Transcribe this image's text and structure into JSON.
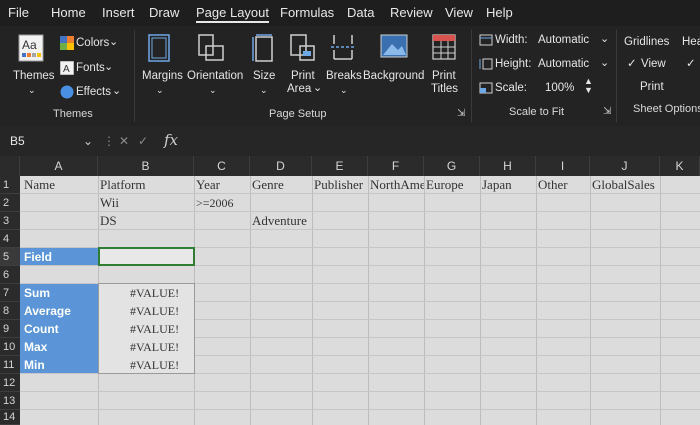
{
  "menu": {
    "tabs": [
      "File",
      "Home",
      "Insert",
      "Draw",
      "Page Layout",
      "Formulas",
      "Data",
      "Review",
      "View",
      "Help"
    ],
    "active_tab": "Page Layout"
  },
  "ribbon": {
    "themes": {
      "themes_label": "Themes",
      "colors_label": "Colors",
      "fonts_label": "Fonts",
      "effects_label": "Effects",
      "group_label": "Themes"
    },
    "page_setup": {
      "margins_label": "Margins",
      "orientation_label": "Orientation",
      "size_label": "Size",
      "print_area_label_1": "Print",
      "print_area_label_2": "Area",
      "breaks_label": "Breaks",
      "background_label": "Background",
      "print_titles_label_1": "Print",
      "print_titles_label_2": "Titles",
      "group_label": "Page Setup"
    },
    "scale_to_fit": {
      "width_label": "Width:",
      "width_value": "Automatic",
      "height_label": "Height:",
      "height_value": "Automatic",
      "scale_label": "Scale:",
      "scale_value": "100%",
      "group_label": "Scale to Fit"
    },
    "sheet_options": {
      "gridlines_label": "Gridlines",
      "headings_label": "Hea",
      "view_label": "View",
      "print_label": "Print",
      "group_label": "Sheet Options"
    }
  },
  "formula_bar": {
    "name_box": "B5",
    "fx": "fx",
    "formula": ""
  },
  "columns": [
    "A",
    "B",
    "C",
    "D",
    "E",
    "F",
    "G",
    "H",
    "I",
    "J",
    "K"
  ],
  "rows": [
    "1",
    "2",
    "3",
    "4",
    "5",
    "6",
    "7",
    "8",
    "9",
    "10",
    "11",
    "12",
    "13",
    "14"
  ],
  "cells": {
    "A1": "Name",
    "B1": "Platform",
    "C1": "Year",
    "D1": "Genre",
    "E1": "Publisher",
    "F1": "NorthAme",
    "G1": "Europe",
    "H1": "Japan",
    "I1": "Other",
    "J1": "GlobalSales",
    "B2": "Wii",
    "C2": ">=2006",
    "B3": "DS",
    "D3": "Adventure",
    "A5": "Field",
    "A7": "Sum",
    "A8": "Average",
    "A9": "Count",
    "A10": "Max",
    "A11": "Min",
    "B7": "#VALUE!",
    "B8": "#VALUE!",
    "B9": "#VALUE!",
    "B10": "#VALUE!",
    "B11": "#VALUE!"
  },
  "colors": {
    "accent_blue": "#5b95d8",
    "sheet_bg": "#dcdcdc",
    "ribbon_bg": "#232323",
    "selected_border": "#2e7d32"
  }
}
